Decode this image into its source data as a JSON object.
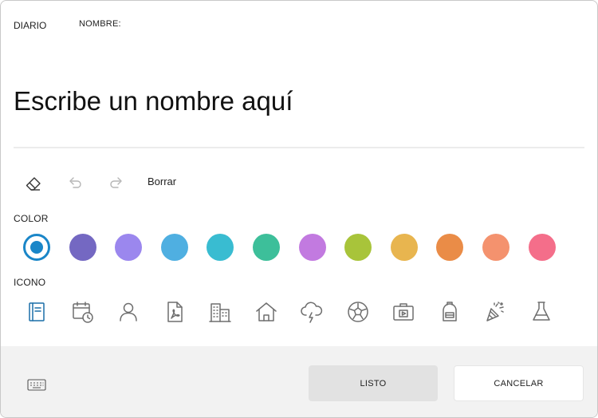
{
  "header": {
    "diario_label": "DIARIO",
    "nombre_label": "NOMBRE:"
  },
  "name_field": {
    "placeholder": "Escribe un nombre aquí"
  },
  "toolbar": {
    "eraser_icon": "eraser-icon",
    "undo_icon": "undo-icon",
    "redo_icon": "redo-icon",
    "clear_label": "Borrar"
  },
  "color_section": {
    "label": "COLOR",
    "selected_index": 0,
    "colors": [
      "#1a86c8",
      "#7468c2",
      "#9b87ee",
      "#4fafe1",
      "#39bcd1",
      "#3dbf9a",
      "#c27ae0",
      "#a8c43a",
      "#e8b54f",
      "#ea8c47",
      "#f4926e",
      "#f46e8a"
    ]
  },
  "icon_section": {
    "label": "ICONO",
    "icons": [
      "notebook-icon",
      "calendar-clock-icon",
      "person-icon",
      "pdf-document-icon",
      "buildings-icon",
      "house-icon",
      "storm-cloud-icon",
      "soccer-ball-icon",
      "suitcase-icon",
      "backpack-icon",
      "party-popper-icon",
      "flask-icon"
    ],
    "selected_color": "#1a6fa8",
    "default_color": "#6e6e6e"
  },
  "footer": {
    "keyboard_icon": "keyboard-icon",
    "done_label": "LISTO",
    "cancel_label": "CANCELAR"
  }
}
